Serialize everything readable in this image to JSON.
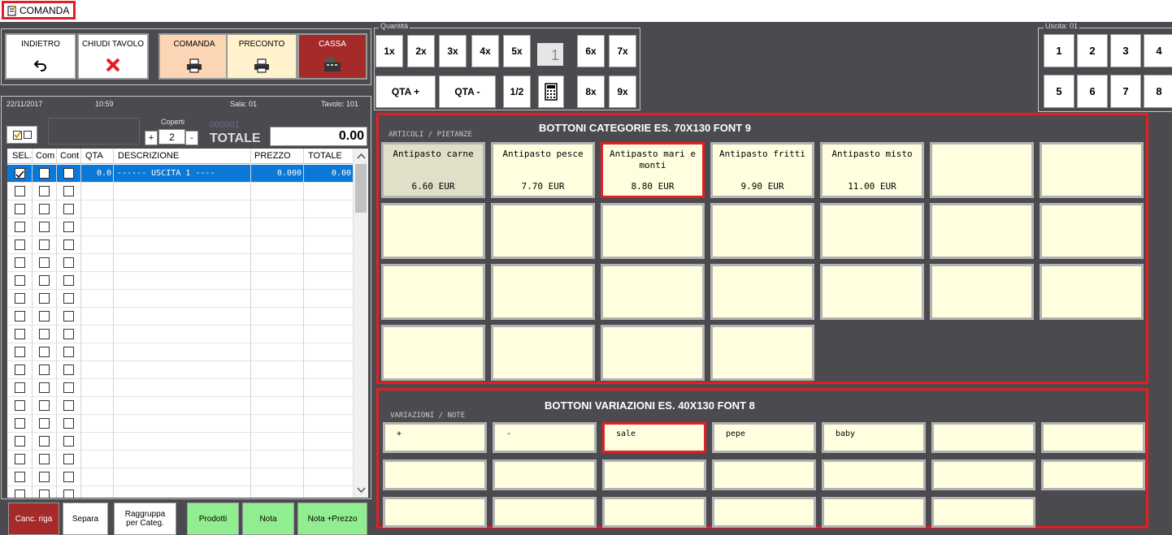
{
  "window": {
    "title": "COMANDA"
  },
  "toolbar": {
    "indietro": "INDIETRO",
    "chiudi": "CHIUDI TAVOLO",
    "comanda": "COMANDA",
    "preconto": "PRECONTO",
    "cassa": "CASSA"
  },
  "quantita": {
    "legend": "Quantità",
    "row1": [
      "1x",
      "2x",
      "3x",
      "4x",
      "5x"
    ],
    "current": "1",
    "row1b": [
      "6x",
      "7x"
    ],
    "qta_plus": "QTA +",
    "qta_minus": "QTA -",
    "half": "1/2",
    "row2b": [
      "8x",
      "9x"
    ]
  },
  "uscita": {
    "legend": "Uscita: 01",
    "buttons": [
      "1",
      "2",
      "3",
      "4",
      "5",
      "6",
      "7",
      "8"
    ]
  },
  "info": {
    "date": "22/11/2017",
    "time": "10:59",
    "sala": "Sala: 01",
    "tavolo": "Tavolo: 101",
    "coperti_label": "Coperti",
    "coperti_value": "2",
    "plus": "+",
    "minus": "-",
    "order_no": "000001",
    "totale_label": "TOTALE",
    "totale_value": "0.00"
  },
  "grid": {
    "headers": [
      "SEL.",
      "Com",
      "Cont",
      "QTA",
      "DESCRIZIONE",
      "PREZZO",
      "TOTALE"
    ],
    "rows": [
      {
        "qta": "0.0",
        "desc": "------ USCITA  1 ----",
        "prezzo": "0.000",
        "totale": "0.00",
        "sel": true
      }
    ]
  },
  "categorie": {
    "title": "BOTTONI CATEGORIE ES. 70X130 FONT 9",
    "subtitle": "ARTICOLI / PIETANZE",
    "items": [
      {
        "name": "Antipasto carne",
        "price": "6.60 EUR"
      },
      {
        "name": "Antipasto pesce",
        "price": "7.70 EUR"
      },
      {
        "name": "Antipasto mari e monti",
        "price": "8.80 EUR"
      },
      {
        "name": "Antipasto fritti",
        "price": "9.90 EUR"
      },
      {
        "name": "Antipasto misto",
        "price": "11.00 EUR"
      }
    ]
  },
  "variazioni": {
    "title": "BOTTONI VARIAZIONI ES. 40X130 FONT 8",
    "subtitle": "VARIAZIONI / NOTE",
    "items": [
      "+",
      "-",
      "sale",
      "pepe",
      "baby"
    ]
  },
  "bottom": {
    "canc": "Canc. riga",
    "separa": "Separa",
    "raggruppa": "Raggruppa per Categ.",
    "prodotti": "Prodotti",
    "nota": "Nota",
    "nota_prezzo": "Nota +Prezzo"
  },
  "colors": {
    "accent_red": "#e41e24",
    "selected_row": "#0a78d7",
    "button_yellow": "#ffffe0",
    "cassa": "#a52a2a",
    "green": "#90ee90"
  }
}
